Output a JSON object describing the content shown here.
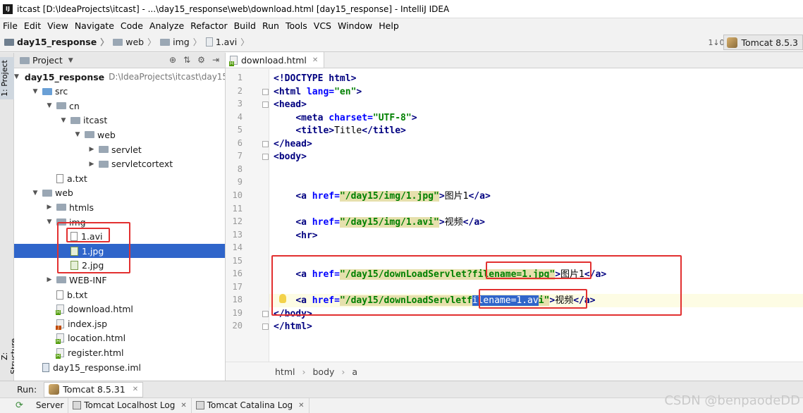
{
  "window": {
    "title": "itcast [D:\\IdeaProjects\\itcast] - ...\\day15_response\\web\\download.html [day15_response] - IntelliJ IDEA",
    "app_icon": "IJ"
  },
  "menu": [
    "File",
    "Edit",
    "View",
    "Navigate",
    "Code",
    "Analyze",
    "Refactor",
    "Build",
    "Run",
    "Tools",
    "VCS",
    "Window",
    "Help"
  ],
  "breadcrumb": [
    "day15_response",
    "web",
    "img",
    "1.avi"
  ],
  "run_config": "Tomcat 8.5.3",
  "sort_icon": "1↓0",
  "left_tabs": {
    "project": "1: Project",
    "structure": "Z: Structure"
  },
  "project_panel": {
    "title": "Project",
    "tree": [
      {
        "label": "day15_response",
        "path": "D:\\IdeaProjects\\itcast\\day15",
        "icon": "module-folder-icon",
        "arrow": "▼",
        "indent": 0,
        "bold": true
      },
      {
        "label": "src",
        "icon": "source-folder-icon",
        "arrow": "▼",
        "indent": 1
      },
      {
        "label": "cn",
        "icon": "package-icon",
        "arrow": "▼",
        "indent": 2
      },
      {
        "label": "itcast",
        "icon": "package-icon",
        "arrow": "▼",
        "indent": 3
      },
      {
        "label": "web",
        "icon": "package-icon",
        "arrow": "▼",
        "indent": 4
      },
      {
        "label": "servlet",
        "icon": "package-icon",
        "arrow": "▶",
        "indent": 5
      },
      {
        "label": "servletcortext",
        "icon": "package-icon",
        "arrow": "▶",
        "indent": 5
      },
      {
        "label": "a.txt",
        "icon": "text-file-icon",
        "arrow": "",
        "indent": 2
      },
      {
        "label": "web",
        "icon": "web-folder-icon",
        "arrow": "▼",
        "indent": 1
      },
      {
        "label": "htmls",
        "icon": "folder-icon",
        "arrow": "▶",
        "indent": 2
      },
      {
        "label": "img",
        "icon": "folder-icon",
        "arrow": "▼",
        "indent": 2
      },
      {
        "label": "1.avi",
        "icon": "video-file-icon",
        "arrow": "",
        "indent": 3
      },
      {
        "label": "1.jpg",
        "icon": "image-file-icon",
        "arrow": "",
        "indent": 3,
        "selected": true
      },
      {
        "label": "2.jpg",
        "icon": "image-file-icon",
        "arrow": "",
        "indent": 3
      },
      {
        "label": "WEB-INF",
        "icon": "folder-icon",
        "arrow": "▶",
        "indent": 2
      },
      {
        "label": "b.txt",
        "icon": "text-file-icon",
        "arrow": "",
        "indent": 2
      },
      {
        "label": "download.html",
        "icon": "html-file-icon",
        "arrow": "",
        "indent": 2
      },
      {
        "label": "index.jsp",
        "icon": "jsp-file-icon",
        "arrow": "",
        "indent": 2
      },
      {
        "label": "location.html",
        "icon": "html-file-icon",
        "arrow": "",
        "indent": 2
      },
      {
        "label": "register.html",
        "icon": "html-file-icon",
        "arrow": "",
        "indent": 2
      },
      {
        "label": "day15_response.iml",
        "icon": "iml-file-icon",
        "arrow": "",
        "indent": 1
      }
    ]
  },
  "editor": {
    "tab": "download.html",
    "lines": [
      {
        "n": "1",
        "html": "<span class='tag'>&lt;!DOCTYPE html&gt;</span>"
      },
      {
        "n": "2",
        "html": "<span class='tag'>&lt;html</span> <span class='attr'>lang=</span><span class='str'>\"en\"</span><span class='tag'>&gt;</span>"
      },
      {
        "n": "3",
        "html": "<span class='tag'>&lt;head&gt;</span>"
      },
      {
        "n": "4",
        "html": "    <span class='tag'>&lt;meta</span> <span class='attr'>charset=</span><span class='str'>\"UTF-8\"</span><span class='tag'>&gt;</span>"
      },
      {
        "n": "5",
        "html": "    <span class='tag'>&lt;title&gt;</span>Title<span class='tag'>&lt;/title&gt;</span>"
      },
      {
        "n": "6",
        "html": "<span class='tag'>&lt;/head&gt;</span>"
      },
      {
        "n": "7",
        "html": "<span class='tag'>&lt;body&gt;</span>"
      },
      {
        "n": "8",
        "html": ""
      },
      {
        "n": "9",
        "html": ""
      },
      {
        "n": "10",
        "html": "    <span class='tag'>&lt;a</span> <span class='attr'>href=</span><span class='str hl'>\"/day15/img/1.jpg\"</span><span class='tag'>&gt;</span>图片1<span class='tag'>&lt;/a&gt;</span>"
      },
      {
        "n": "11",
        "html": ""
      },
      {
        "n": "12",
        "html": "    <span class='tag'>&lt;a</span> <span class='attr'>href=</span><span class='str hl'>\"/day15/img/1.avi\"</span><span class='tag'>&gt;</span>视频<span class='tag'>&lt;/a&gt;</span>"
      },
      {
        "n": "13",
        "html": "    <span class='tag'>&lt;hr&gt;</span>"
      },
      {
        "n": "14",
        "html": ""
      },
      {
        "n": "15",
        "html": ""
      },
      {
        "n": "16",
        "html": "    <span class='tag'>&lt;a</span> <span class='attr'>href=</span><span class='str hl'>\"/day15/downLoadServlet?filename=1.jpg\"</span><span class='tag'>&gt;</span>图片1<span class='tag'>&lt;/a&gt;</span>"
      },
      {
        "n": "17",
        "html": ""
      },
      {
        "n": "18",
        "html": "    <span class='tag'>&lt;a</span> <span class='attr'>href=</span><span class='str hl'>\"/day15/downLoadServletf</span><span class='sel'>ilename=1.av</span><span class='str hl'>i\"</span><span class='tag'>&gt;</span>视频<span class='tag'>&lt;/a&gt;</span>"
      },
      {
        "n": "19",
        "html": "<span class='tag'>&lt;/body&gt;</span>"
      },
      {
        "n": "20",
        "html": "<span class='tag'>&lt;/html&gt;</span>"
      }
    ],
    "breadcrumb": [
      "html",
      "body",
      "a"
    ]
  },
  "run": {
    "label": "Run:",
    "config_tab": "Tomcat 8.5.31",
    "sub_tabs": [
      "Server",
      "Tomcat Localhost Log",
      "Tomcat Catalina Log"
    ]
  },
  "watermark": "CSDN @benpaodeDD"
}
